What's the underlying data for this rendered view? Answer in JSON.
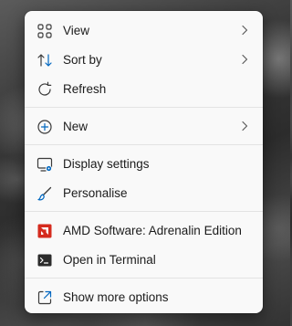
{
  "menu": {
    "view": {
      "label": "View",
      "icon": "view-grid-icon",
      "has_submenu": true
    },
    "sort_by": {
      "label": "Sort by",
      "icon": "sort-icon",
      "has_submenu": true
    },
    "refresh": {
      "label": "Refresh",
      "icon": "refresh-icon"
    },
    "new": {
      "label": "New",
      "icon": "new-plus-icon",
      "has_submenu": true
    },
    "display_settings": {
      "label": "Display settings",
      "icon": "display-settings-icon"
    },
    "personalise": {
      "label": "Personalise",
      "icon": "brush-icon"
    },
    "amd": {
      "label": "AMD Software: Adrenalin Edition",
      "icon": "amd-logo-icon"
    },
    "terminal": {
      "label": "Open in Terminal",
      "icon": "terminal-icon"
    },
    "more_options": {
      "label": "Show more options",
      "icon": "show-more-options-icon"
    }
  },
  "colors": {
    "menu_background": "#f9f9f9",
    "text": "#1b1b1b",
    "accent": "#0067c0",
    "amd_red": "#d52b1e",
    "separator": "#e3e3e3"
  }
}
